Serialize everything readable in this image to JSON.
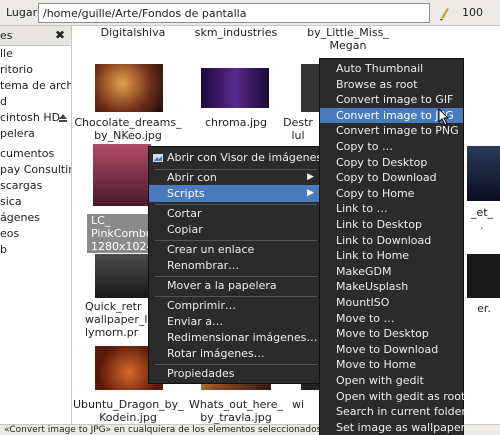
{
  "location": {
    "label": "Lugar:",
    "path": "/home/guille/Arte/Fondos de pantalla",
    "zoom": "100"
  },
  "sidebar": {
    "header": "es",
    "items": [
      "lle",
      "ritorio",
      "tema de archi…",
      "d",
      "cintosh HD",
      "pelera",
      "cumentos",
      "pay Consulting",
      "scargas",
      "sica",
      "ágenes",
      "eos",
      "b"
    ]
  },
  "files": {
    "top_row": [
      "Digitalshiva",
      "skm_industries",
      "by_Little_Miss_\nMegan",
      "100"
    ],
    "row2": [
      "Chocolate_dreams_\nby_NKeo.jpg",
      "chroma.jpg",
      "Destr\nlul"
    ],
    "row3_selected": "LC_\nPinkCombust\n1280x1024.",
    "row3_right": "_et_\n.",
    "row4": "Quick_retr\nwallpaper_l\nlymorn.pr",
    "row4_right": "er.",
    "row5": [
      "Ubuntu_Dragon_by_\nKodein.jpg",
      "Whats_out_here_\nby_travla.jpg",
      "wi"
    ]
  },
  "context_menu": {
    "items": [
      {
        "label": "Abrir con Visor de imágenes",
        "icon": "image-viewer-icon"
      },
      {
        "label": "Abrir con",
        "submenu": true
      },
      {
        "label": "Scripts",
        "submenu": true,
        "highlighted": true
      },
      {
        "label": "Cortar"
      },
      {
        "label": "Copiar"
      },
      {
        "label": "Crear un enlace"
      },
      {
        "label": "Renombrar…"
      },
      {
        "label": "Mover a la papelera"
      },
      {
        "label": "Comprimir…"
      },
      {
        "label": "Enviar a…"
      },
      {
        "label": "Redimensionar imágenes…"
      },
      {
        "label": "Rotar imágenes…"
      },
      {
        "label": "Propiedades"
      }
    ]
  },
  "scripts_submenu": {
    "items": [
      "Auto Thumbnail",
      "Browse as root",
      "Convert image to GIF",
      "Convert image to JPG",
      "Convert image to PNG",
      "Copy to …",
      "Copy to Desktop",
      "Copy to Download",
      "Copy to Home",
      "Link to …",
      "Link to Desktop",
      "Link to Download",
      "Link to Home",
      "MakeGDM",
      "MakeUsplash",
      "MountISO",
      "Move to …",
      "Move to Desktop",
      "Move to Download",
      "Move to Home",
      "Open with gedit",
      "Open with gedit as root",
      "Search in current folder",
      "Set image as wallpaper"
    ],
    "highlighted_index": 3
  },
  "status": "«Convert image to JPG» en cualquiera de los elementos seleccionados",
  "colors": {
    "menu_bg": "#2b2b2b",
    "highlight": "#4a7bbf",
    "selection": "#8a8a8a"
  }
}
